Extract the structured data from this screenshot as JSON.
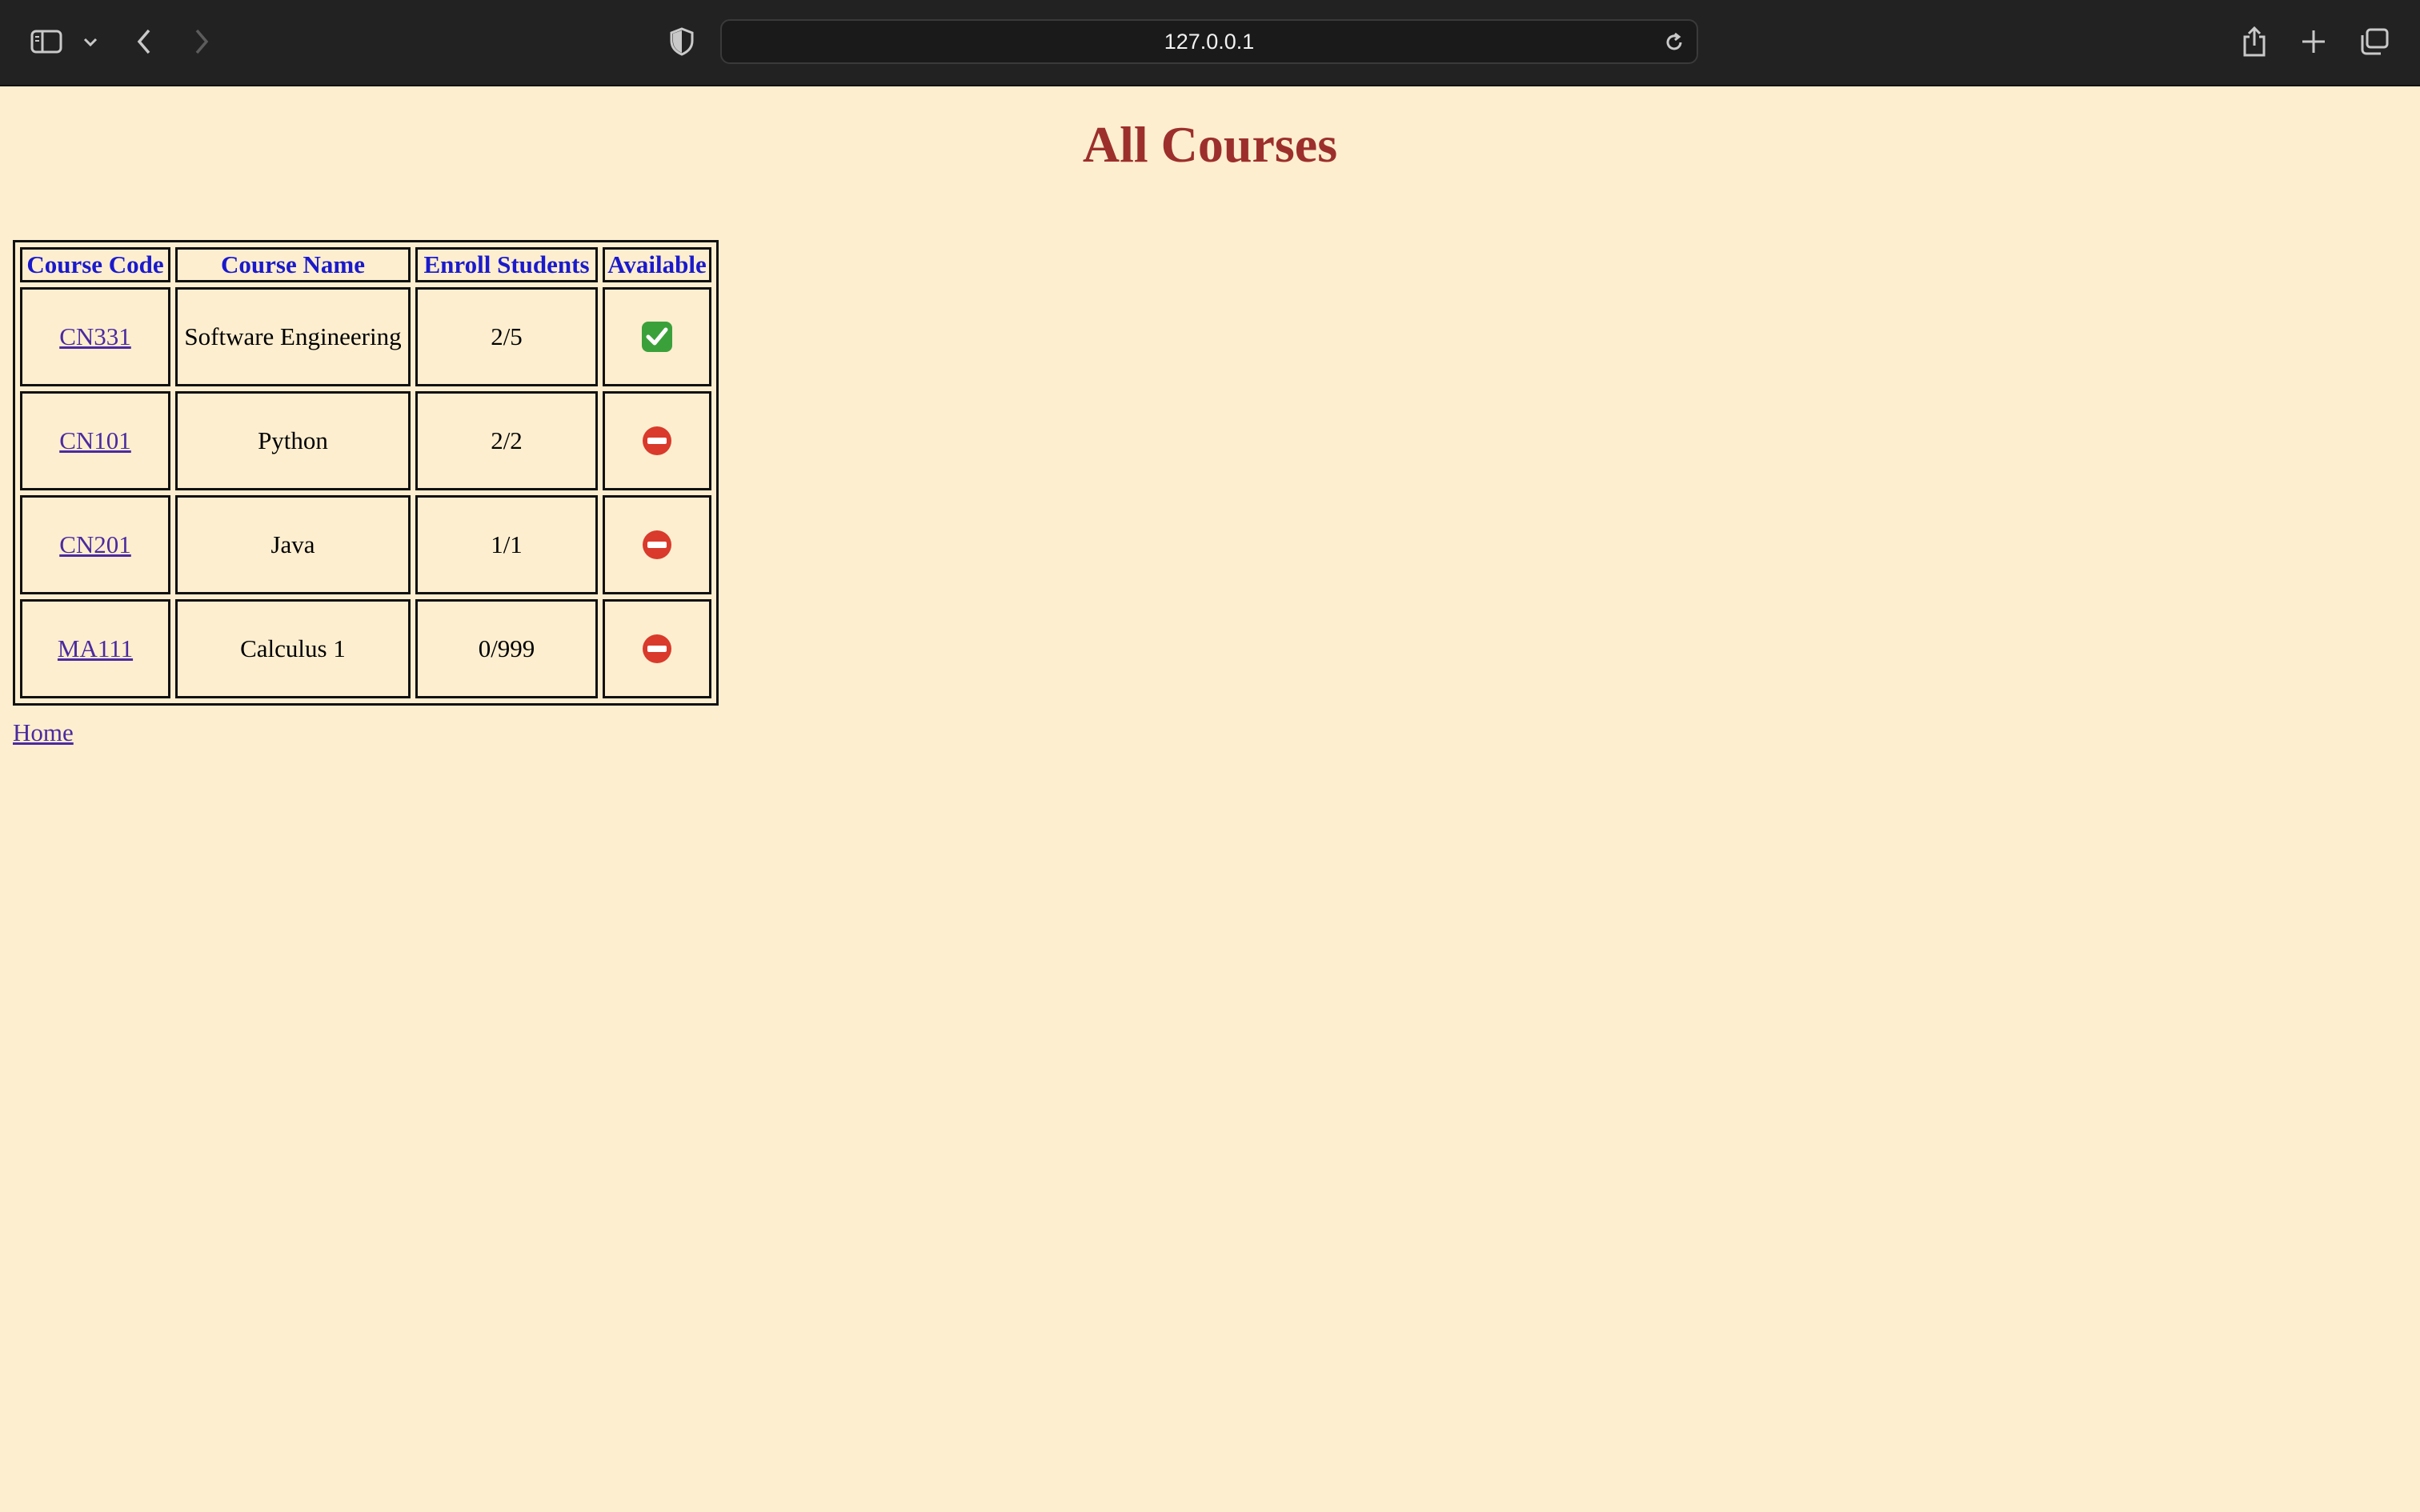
{
  "browser": {
    "url": "127.0.0.1"
  },
  "page": {
    "title": "All Courses",
    "home_link": "Home"
  },
  "table": {
    "headers": [
      "Course Code",
      "Course Name",
      "Enroll Students",
      "Available"
    ],
    "rows": [
      {
        "code": "CN331",
        "name": "Software Engineering",
        "enroll": "2/5",
        "available": true,
        "icon": "check-mark-icon"
      },
      {
        "code": "CN101",
        "name": "Python",
        "enroll": "2/2",
        "available": false,
        "icon": "no-entry-icon"
      },
      {
        "code": "CN201",
        "name": "Java",
        "enroll": "1/1",
        "available": false,
        "icon": "no-entry-icon"
      },
      {
        "code": "MA111",
        "name": "Calculus 1",
        "enroll": "0/999",
        "available": false,
        "icon": "no-entry-icon"
      }
    ]
  },
  "colors": {
    "page_background": "#fdeecf",
    "title": "#9c2f2c",
    "header_text": "#1a1acc",
    "link": "#4b2aa0",
    "available": "#3aa13a",
    "unavailable": "#d93a2b"
  }
}
